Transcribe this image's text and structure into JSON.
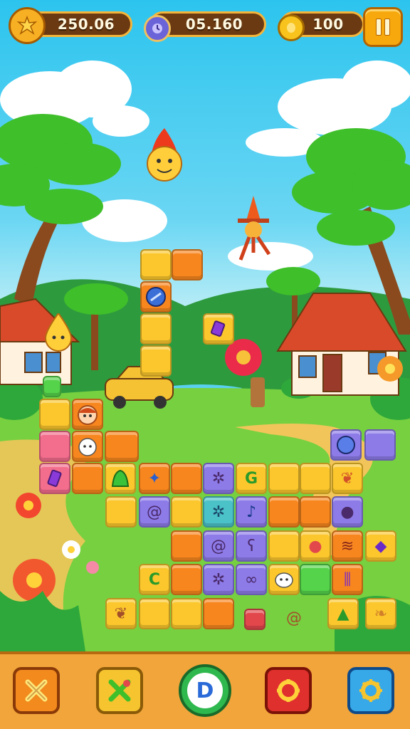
{
  "hud": {
    "score_value": "250.06",
    "time_value": "05.160",
    "coins_value": "100"
  },
  "icons": {
    "score": "splat-star-icon",
    "time": "stopwatch-icon",
    "coins": "gold-coin-icon",
    "pause": "pause-icon"
  },
  "bottom_bar": {
    "buttons": [
      {
        "name": "close-button",
        "glyph": "✕",
        "color": "#f28a1e"
      },
      {
        "name": "swap-tool-button",
        "glyph": "✕",
        "color": "#f5c42e"
      },
      {
        "name": "center-d-button",
        "glyph": "D",
        "color": "#2fb84d"
      },
      {
        "name": "red-settings-button",
        "glyph": "✹",
        "color": "#e0302e"
      },
      {
        "name": "blue-settings-button",
        "glyph": "✹",
        "color": "#38a9e8"
      }
    ]
  },
  "colors": {
    "sky": "#2cc4ee",
    "grass": "#6ccb3c",
    "hud_pill": "#6b3a12",
    "bar": "#f1a53a"
  }
}
